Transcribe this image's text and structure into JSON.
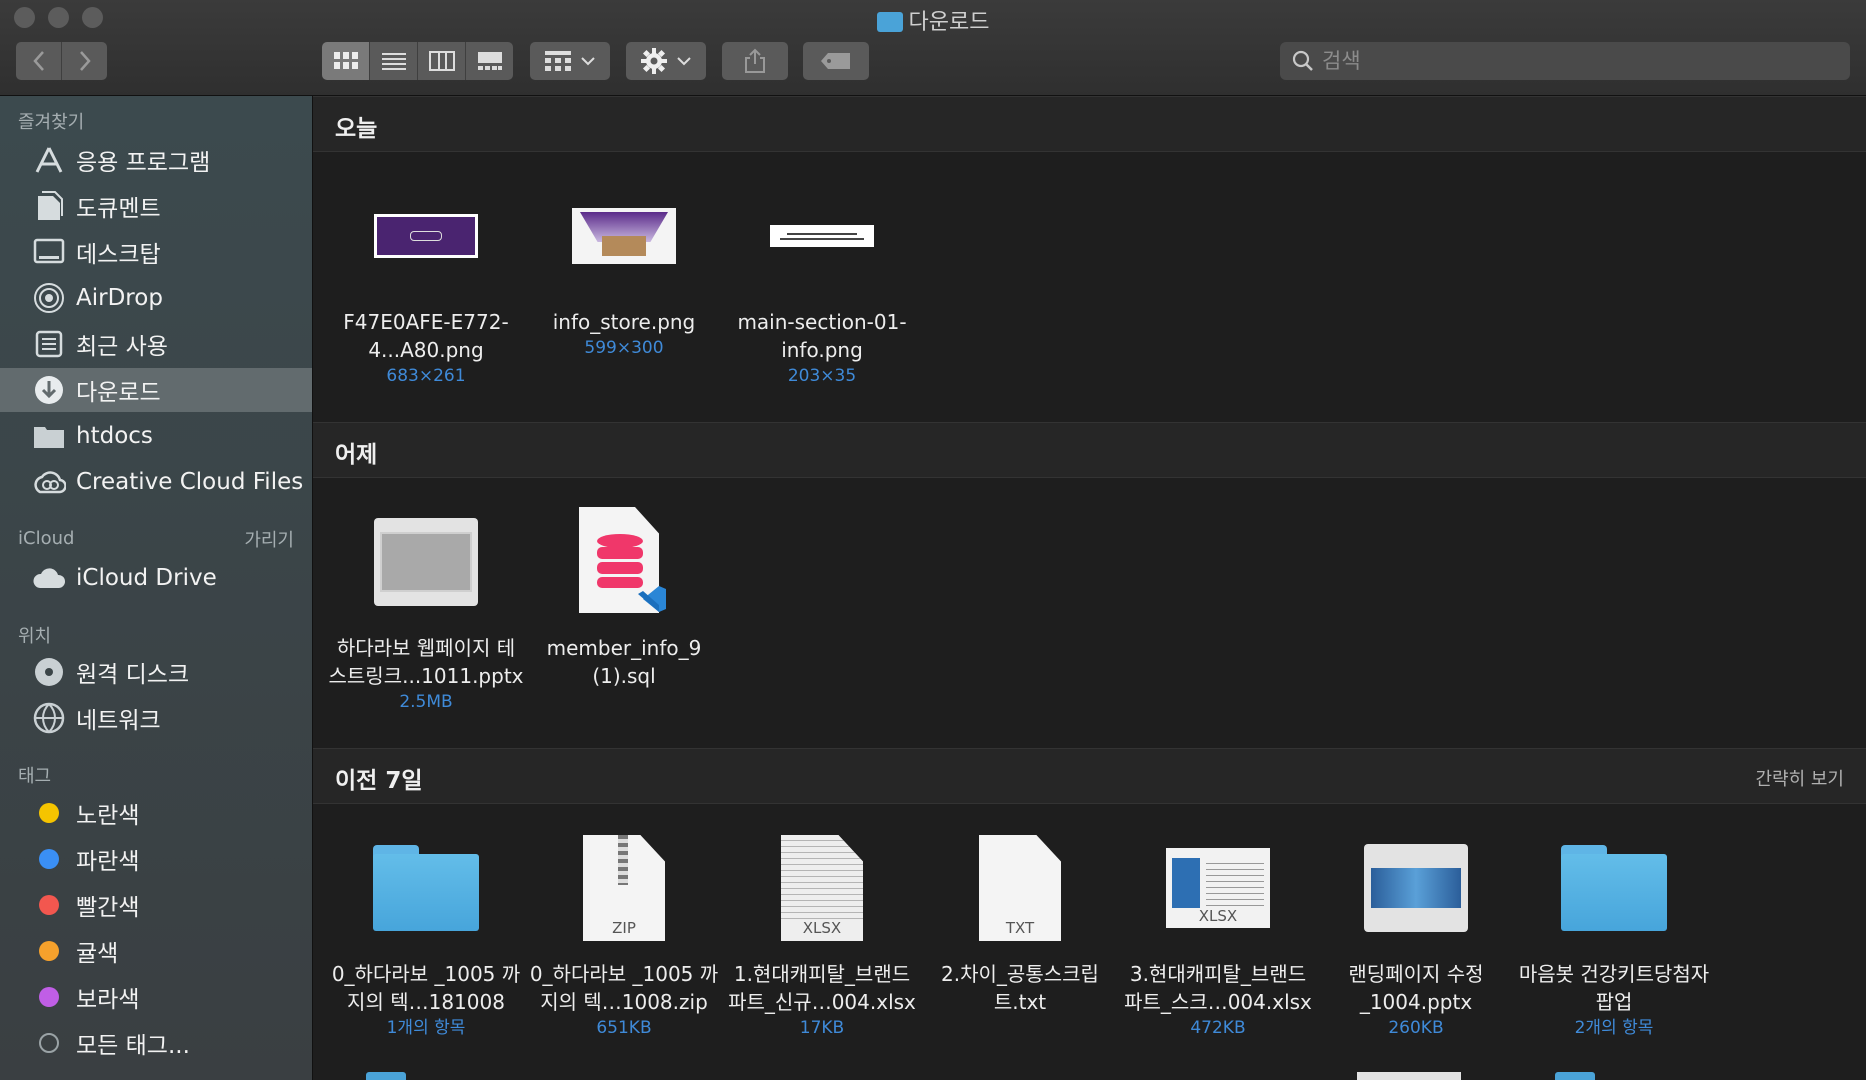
{
  "window": {
    "title": "다운로드"
  },
  "search": {
    "placeholder": "검색"
  },
  "sidebar": {
    "favorites_header": "즐겨찾기",
    "favorites": [
      {
        "label": "응용 프로그램",
        "icon": "applications-icon"
      },
      {
        "label": "도큐멘트",
        "icon": "documents-icon"
      },
      {
        "label": "데스크탑",
        "icon": "desktop-icon"
      },
      {
        "label": "AirDrop",
        "icon": "airdrop-icon"
      },
      {
        "label": "최근 사용",
        "icon": "recents-icon"
      },
      {
        "label": "다운로드",
        "icon": "downloads-icon",
        "selected": true
      },
      {
        "label": "htdocs",
        "icon": "folder-icon"
      },
      {
        "label": "Creative Cloud Files",
        "icon": "creative-cloud-icon"
      }
    ],
    "icloud_header": "iCloud",
    "icloud_hide": "가리기",
    "icloud": [
      {
        "label": "iCloud Drive",
        "icon": "cloud-icon"
      }
    ],
    "locations_header": "위치",
    "locations": [
      {
        "label": "원격 디스크",
        "icon": "disc-icon"
      },
      {
        "label": "네트워크",
        "icon": "network-icon"
      }
    ],
    "tags_header": "태그",
    "tags": [
      {
        "label": "노란색",
        "color": "#f5c400"
      },
      {
        "label": "파란색",
        "color": "#3a8ff5"
      },
      {
        "label": "빨간색",
        "color": "#f2574f"
      },
      {
        "label": "귤색",
        "color": "#f6a12c"
      },
      {
        "label": "보라색",
        "color": "#c05ee6"
      },
      {
        "label": "모든 태그...",
        "color": ""
      }
    ]
  },
  "sections": {
    "today": {
      "title": "오늘",
      "items": [
        {
          "name": "F47E0AFE-E772-4...A80.png",
          "meta": "683×261",
          "kind": "image-purple"
        },
        {
          "name": "info_store.png",
          "meta": "599×300",
          "kind": "image-store"
        },
        {
          "name": "main-section-01-info.png",
          "meta": "203×35",
          "kind": "image-banner"
        }
      ]
    },
    "yesterday": {
      "title": "어제",
      "items": [
        {
          "name": "하다라보 웹페이지 테스트링크...1011.pptx",
          "meta": "2.5MB",
          "kind": "pptx"
        },
        {
          "name": "member_info_9 (1).sql",
          "meta": "",
          "kind": "sql"
        }
      ]
    },
    "previous7": {
      "title": "이전 7일",
      "collapse": "간략히 보기",
      "items": [
        {
          "name": "0_하다라보 _1005 까지의 텍…181008",
          "meta": "1개의 항목",
          "kind": "folder"
        },
        {
          "name": "0_하다라보 _1005 까지의 텍…1008.zip",
          "meta": "651KB",
          "kind": "zip",
          "label": "ZIP"
        },
        {
          "name": "1.현대캐피탈_브랜드 파트_신규…004.xlsx",
          "meta": "17KB",
          "kind": "xlsx",
          "label": "XLSX"
        },
        {
          "name": "2.차이_공통스크립트.txt",
          "meta": "",
          "kind": "txt",
          "label": "TXT"
        },
        {
          "name": "3.현대캐피탈_브랜드 파트_스크…004.xlsx",
          "meta": "472KB",
          "kind": "xlsx2",
          "label": "XLSX"
        },
        {
          "name": "랜딩페이지 수정_1004.pptx",
          "meta": "260KB",
          "kind": "pptx2"
        },
        {
          "name": "마음봇 건강키트당첨자 팝업",
          "meta": "2개의 항목",
          "kind": "folder"
        }
      ]
    }
  }
}
